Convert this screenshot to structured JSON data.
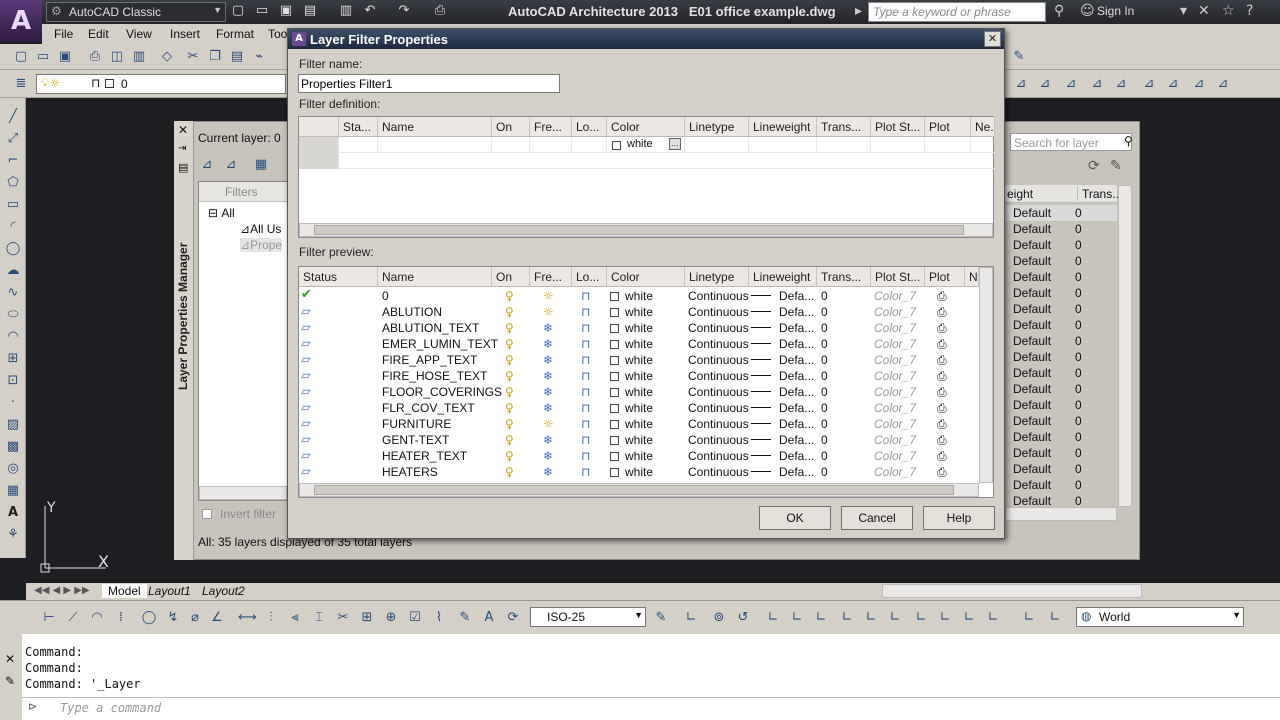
{
  "app": {
    "title": "AutoCAD Architecture 2013",
    "filename": "E01 office example.dwg",
    "workspace": "AutoCAD Classic",
    "search_placeholder": "Type a keyword or phrase",
    "sign_in": "Sign In"
  },
  "menu": [
    "File",
    "Edit",
    "View",
    "Insert",
    "Format",
    "Too"
  ],
  "current_layer_select": "0",
  "layer_manager": {
    "title": "Layer Properties Manager",
    "current_layer": "Current layer: 0",
    "filters_label": "Filters",
    "tree": [
      "All",
      "All Us",
      "Prope"
    ],
    "invert_filter": "Invert filter",
    "status": "All: 35 layers displayed of 35 total layers",
    "search_placeholder": "Search for layer",
    "right_columns": [
      "eight",
      "Trans..."
    ],
    "right_rows": [
      {
        "lw": "Default",
        "t": "0"
      },
      {
        "lw": "Default",
        "t": "0"
      },
      {
        "lw": "Default",
        "t": "0"
      },
      {
        "lw": "Default",
        "t": "0"
      },
      {
        "lw": "Default",
        "t": "0"
      },
      {
        "lw": "Default",
        "t": "0"
      },
      {
        "lw": "Default",
        "t": "0"
      },
      {
        "lw": "Default",
        "t": "0"
      },
      {
        "lw": "Default",
        "t": "0"
      },
      {
        "lw": "Default",
        "t": "0"
      },
      {
        "lw": "Default",
        "t": "0"
      },
      {
        "lw": "Default",
        "t": "0"
      },
      {
        "lw": "Default",
        "t": "0"
      },
      {
        "lw": "Default",
        "t": "0"
      },
      {
        "lw": "Default",
        "t": "0"
      },
      {
        "lw": "Default",
        "t": "0"
      },
      {
        "lw": "Default",
        "t": "0"
      },
      {
        "lw": "Default",
        "t": "0"
      },
      {
        "lw": "Default",
        "t": "0"
      }
    ]
  },
  "dialog": {
    "title": "Layer Filter Properties",
    "filter_name_label": "Filter name:",
    "filter_name_value": "Properties Filter1",
    "filter_definition_label": "Filter definition:",
    "definition_columns": [
      "Sta...",
      "Name",
      "On",
      "Fre...",
      "Lo...",
      "Color",
      "Linetype",
      "Lineweight",
      "Trans...",
      "Plot St...",
      "Plot",
      "Ne..."
    ],
    "definition_color_value": "white",
    "filter_preview_label": "Filter preview:",
    "preview_columns": [
      "Status",
      "Name",
      "On",
      "Fre...",
      "Lo...",
      "Color",
      "Linetype",
      "Lineweight",
      "Trans...",
      "Plot St...",
      "Plot",
      "N"
    ],
    "layers": [
      {
        "name": "0",
        "color": "white",
        "linetype": "Continuous",
        "lineweight": "Defa...",
        "trans": "0",
        "plotstyle": "Color_7",
        "current": true,
        "frozen": false
      },
      {
        "name": "ABLUTION",
        "color": "white",
        "linetype": "Continuous",
        "lineweight": "Defa...",
        "trans": "0",
        "plotstyle": "Color_7",
        "current": false,
        "frozen": false
      },
      {
        "name": "ABLUTION_TEXT",
        "color": "white",
        "linetype": "Continuous",
        "lineweight": "Defa...",
        "trans": "0",
        "plotstyle": "Color_7",
        "current": false,
        "frozen": true
      },
      {
        "name": "EMER_LUMIN_TEXT",
        "color": "white",
        "linetype": "Continuous",
        "lineweight": "Defa...",
        "trans": "0",
        "plotstyle": "Color_7",
        "current": false,
        "frozen": true
      },
      {
        "name": "FIRE_APP_TEXT",
        "color": "white",
        "linetype": "Continuous",
        "lineweight": "Defa...",
        "trans": "0",
        "plotstyle": "Color_7",
        "current": false,
        "frozen": true
      },
      {
        "name": "FIRE_HOSE_TEXT",
        "color": "white",
        "linetype": "Continuous",
        "lineweight": "Defa...",
        "trans": "0",
        "plotstyle": "Color_7",
        "current": false,
        "frozen": true
      },
      {
        "name": "FLOOR_COVERINGS",
        "color": "white",
        "linetype": "Continuous",
        "lineweight": "Defa...",
        "trans": "0",
        "plotstyle": "Color_7",
        "current": false,
        "frozen": true
      },
      {
        "name": "FLR_COV_TEXT",
        "color": "white",
        "linetype": "Continuous",
        "lineweight": "Defa...",
        "trans": "0",
        "plotstyle": "Color_7",
        "current": false,
        "frozen": true
      },
      {
        "name": "FURNITURE",
        "color": "white",
        "linetype": "Continuous",
        "lineweight": "Defa...",
        "trans": "0",
        "plotstyle": "Color_7",
        "current": false,
        "frozen": false
      },
      {
        "name": "GENT-TEXT",
        "color": "white",
        "linetype": "Continuous",
        "lineweight": "Defa...",
        "trans": "0",
        "plotstyle": "Color_7",
        "current": false,
        "frozen": true
      },
      {
        "name": "HEATER_TEXT",
        "color": "white",
        "linetype": "Continuous",
        "lineweight": "Defa...",
        "trans": "0",
        "plotstyle": "Color_7",
        "current": false,
        "frozen": true
      },
      {
        "name": "HEATERS",
        "color": "white",
        "linetype": "Continuous",
        "lineweight": "Defa...",
        "trans": "0",
        "plotstyle": "Color_7",
        "current": false,
        "frozen": true
      }
    ],
    "buttons": {
      "ok": "OK",
      "cancel": "Cancel",
      "help": "Help"
    }
  },
  "layout_tabs": [
    "Model",
    "Layout1",
    "Layout2"
  ],
  "dim_style": "ISO-25",
  "ucs_select": "World",
  "ucs_labels": {
    "x": "X",
    "y": "Y"
  },
  "command_history": [
    "Command:",
    "Command:",
    "Command: '_Layer"
  ],
  "command_placeholder": "Type a command",
  "colors": {
    "accent": "#3d4f6b",
    "check": "#2a9d2a",
    "plotstyle_gray": "#9a9a9a"
  }
}
